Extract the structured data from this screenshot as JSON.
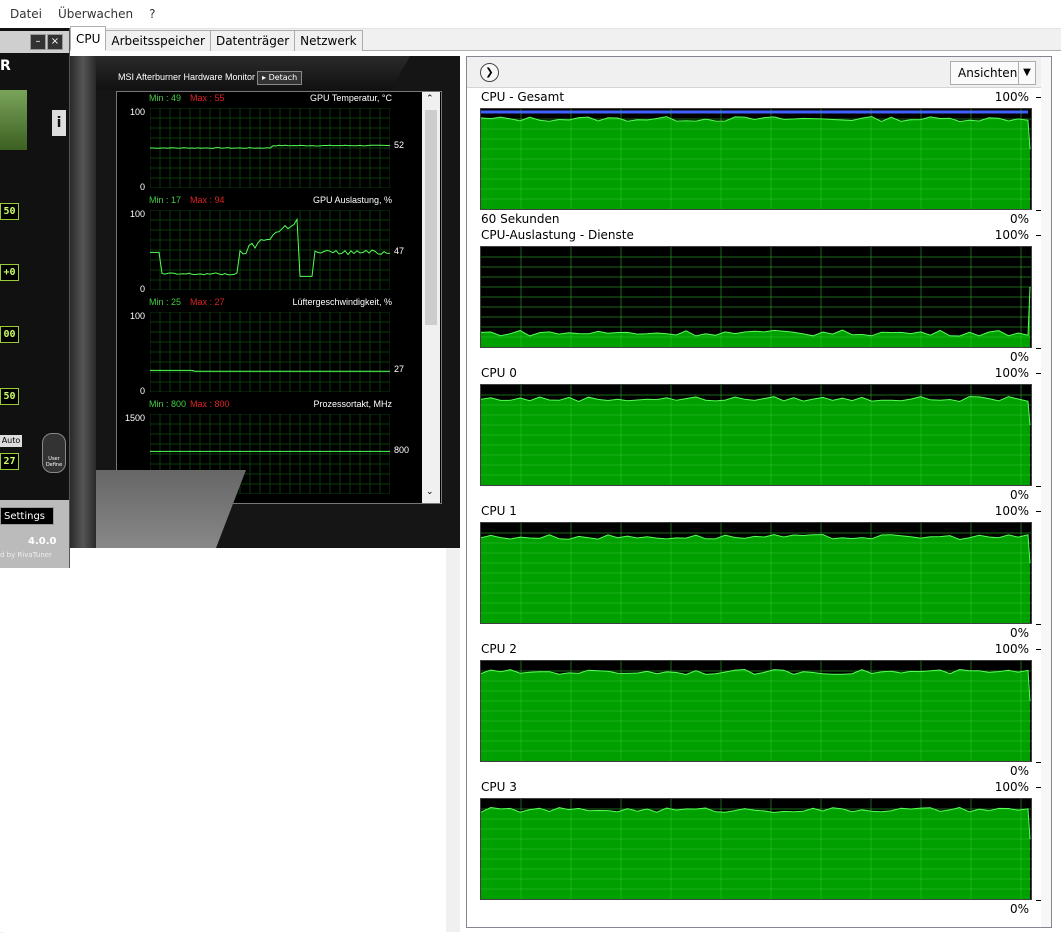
{
  "menu": {
    "items": [
      "Datei",
      "Überwachen",
      "?"
    ]
  },
  "tabs": [
    {
      "label": "CPU",
      "active": true
    },
    {
      "label": "Arbeitsspeicher",
      "active": false
    },
    {
      "label": "Datenträger",
      "active": false
    },
    {
      "label": "Netzwerk",
      "active": false
    }
  ],
  "toolbar": {
    "ansichten_label": "Ansichten"
  },
  "graphs": [
    {
      "title": "CPU - Gesamt",
      "max": "100%",
      "min": "0%",
      "time_label": "60 Sekunden",
      "level": 0.9,
      "blue": true
    },
    {
      "title": "CPU-Auslastung - Dienste",
      "max": "100%",
      "min": "0%",
      "time_label": "",
      "level": 0.14,
      "blue": false
    },
    {
      "title": "CPU 0",
      "max": "100%",
      "min": "0%",
      "time_label": "",
      "level": 0.86,
      "blue": false
    },
    {
      "title": "CPU 1",
      "max": "100%",
      "min": "0%",
      "time_label": "",
      "level": 0.86,
      "blue": false
    },
    {
      "title": "CPU 2",
      "max": "100%",
      "min": "0%",
      "time_label": "",
      "level": 0.89,
      "blue": false
    },
    {
      "title": "CPU 3",
      "max": "100%",
      "min": "0%",
      "time_label": "",
      "level": 0.89,
      "blue": false
    }
  ],
  "afterburner": {
    "monitor_title": "MSI Afterburner Hardware Monitor",
    "detach_label": "Detach",
    "values_left": [
      "50",
      "+0",
      "00",
      "50"
    ],
    "auto_label": "Auto",
    "fan_value": "27",
    "user_define": "User Define",
    "settings_label": "Settings",
    "version": "4.0.0",
    "rivatuner": "d by RivaTuner",
    "graphs": [
      {
        "name": "GPU Temperatur, °C",
        "min": "Min : 49",
        "max": "Max : 55",
        "top": "100",
        "zero": "0",
        "current": "52",
        "level": 0.52
      },
      {
        "name": "GPU Auslastung, %",
        "min": "Min : 17",
        "max": "Max : 94",
        "top": "100",
        "zero": "0",
        "current": "47",
        "level": 0.47
      },
      {
        "name": "Lüftergeschwindigkeit, %",
        "min": "Min : 25",
        "max": "Max : 27",
        "top": "100",
        "zero": "0",
        "current": "27",
        "level": 0.27
      },
      {
        "name": "Prozessortakt, MHz",
        "min": "Min : 800",
        "max": "Max : 800",
        "top": "1500",
        "zero": "0",
        "current": "800",
        "level": 0.533
      }
    ]
  },
  "colors": {
    "graph_green": "#00a000",
    "graph_line": "#55ff55",
    "grid": "#00a000"
  }
}
